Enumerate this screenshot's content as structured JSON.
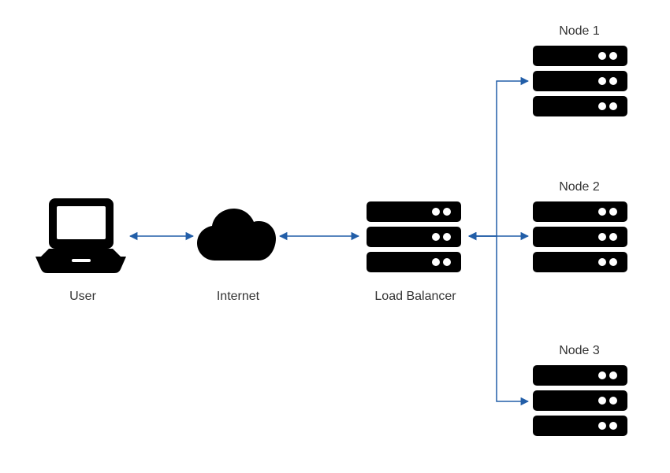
{
  "labels": {
    "user": "User",
    "internet": "Internet",
    "loadBalancer": "Load Balancer",
    "node1": "Node 1",
    "node2": "Node 2",
    "node3": "Node 3"
  },
  "colors": {
    "icon": "#000000",
    "arrow": "#225ea8",
    "text": "#333333"
  },
  "diagram": {
    "type": "network-architecture",
    "nodes": [
      {
        "id": "user",
        "kind": "laptop"
      },
      {
        "id": "internet",
        "kind": "cloud"
      },
      {
        "id": "loadBalancer",
        "kind": "server-stack"
      },
      {
        "id": "node1",
        "kind": "server-stack"
      },
      {
        "id": "node2",
        "kind": "server-stack"
      },
      {
        "id": "node3",
        "kind": "server-stack"
      }
    ],
    "edges": [
      {
        "from": "user",
        "to": "internet",
        "bidirectional": true
      },
      {
        "from": "internet",
        "to": "loadBalancer",
        "bidirectional": true
      },
      {
        "from": "loadBalancer",
        "to": "node1",
        "bidirectional": true
      },
      {
        "from": "loadBalancer",
        "to": "node2",
        "bidirectional": true
      },
      {
        "from": "loadBalancer",
        "to": "node3",
        "bidirectional": true
      }
    ]
  }
}
